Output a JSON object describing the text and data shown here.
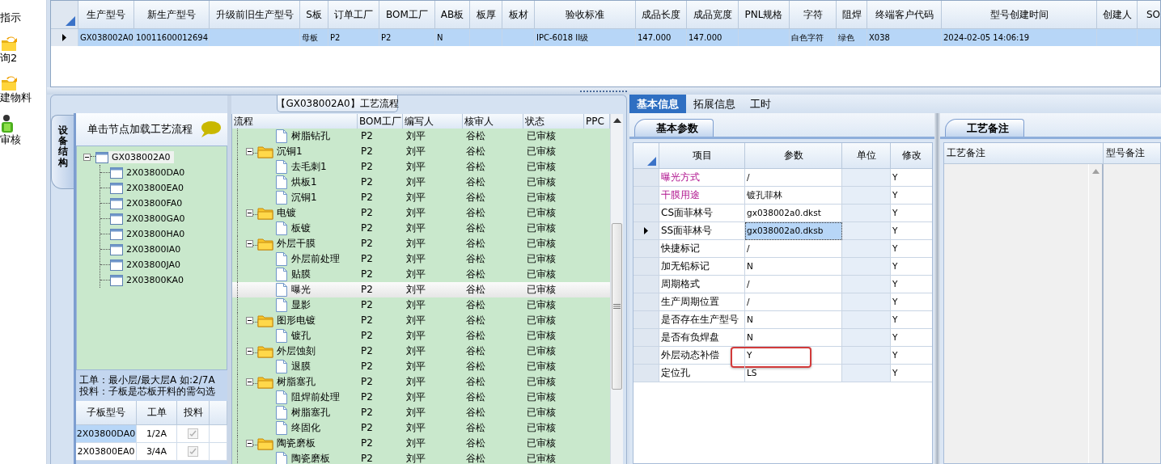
{
  "sidebar": {
    "items": [
      {
        "label": "指示"
      },
      {
        "label": "询2",
        "kind": "folder"
      },
      {
        "label": "建物料",
        "kind": "folder"
      },
      {
        "label": "审核",
        "kind": "approve"
      }
    ]
  },
  "main_grid": {
    "columns": [
      "生产型号",
      "新生产型号",
      "升级前旧生产型号",
      "S板",
      "订单工厂",
      "BOM工厂",
      "AB板",
      "板厚",
      "板材",
      "验收标准",
      "成品长度",
      "成品宽度",
      "PNL规格",
      "字符",
      "阻焊",
      "终端客户代码",
      "型号创建时间",
      "创建人",
      "SO"
    ],
    "rows": [
      {
        "selected": true,
        "cells": [
          "GX038002A0",
          "10011600012694",
          null,
          "母板",
          "P2",
          "P2",
          "N",
          null,
          null,
          "IPC-6018 II级",
          "147.000",
          "147.000",
          null,
          "白色字符",
          "绿色",
          "X038",
          "2024-02-05 14:06:19",
          null,
          null
        ]
      }
    ]
  },
  "structure_panel": {
    "side_tab": "设备结构",
    "hint": "单击节点加载工艺流程",
    "tree": {
      "label": "GX038002A0",
      "expanded": true,
      "selected": true,
      "children": [
        {
          "label": "2X03800DA0",
          "selected": false
        },
        {
          "label": "2X03800EA0",
          "selected": false
        },
        {
          "label": "2X03800FA0",
          "selected": false
        },
        {
          "label": "2X03800GA0",
          "selected": false
        },
        {
          "label": "2X03800HA0",
          "selected": false
        },
        {
          "label": "2X03800IA0",
          "selected": false
        },
        {
          "label": "2X03800JA0",
          "selected": false
        },
        {
          "label": "2X03800KA0",
          "selected": false
        }
      ]
    },
    "notes": [
      "工单：最小层/最大层A 如:2/7A",
      "投料：子板是芯板开料的需勾选"
    ],
    "sub_table": {
      "columns": [
        "子板型号",
        "工单",
        "投料"
      ],
      "rows": [
        {
          "board": "2X03800DA0",
          "order": "1/2A",
          "checked": true,
          "selected": true
        },
        {
          "board": "2X03800EA0",
          "order": "3/4A",
          "checked": true,
          "selected": false
        }
      ]
    }
  },
  "process_panel": {
    "title": "【GX038002A0】工艺流程",
    "columns": [
      "流程",
      "BOM工厂",
      "编写人",
      "核审人",
      "状态",
      "PPC"
    ],
    "nodes": [
      {
        "kind": "folder",
        "children": [
          {
            "kind": "file",
            "label": "树脂钻孔",
            "bom": "P2",
            "writer": "刘平",
            "reviewer": "谷松",
            "status": "已审核",
            "selected": false
          }
        ]
      },
      {
        "kind": "folder",
        "label": "沉铜1",
        "bom": "P2",
        "writer": "刘平",
        "reviewer": "谷松",
        "status": "已审核",
        "selected": false,
        "expanded": true,
        "children": [
          {
            "kind": "file",
            "label": "去毛刺1",
            "bom": "P2",
            "writer": "刘平",
            "reviewer": "谷松",
            "status": "已审核",
            "selected": false
          },
          {
            "kind": "file",
            "label": "烘板1",
            "bom": "P2",
            "writer": "刘平",
            "reviewer": "谷松",
            "status": "已审核",
            "selected": false
          },
          {
            "kind": "file",
            "label": "沉铜1",
            "bom": "P2",
            "writer": "刘平",
            "reviewer": "谷松",
            "status": "已审核",
            "selected": false
          }
        ]
      },
      {
        "kind": "folder",
        "label": "电镀",
        "bom": "P2",
        "writer": "刘平",
        "reviewer": "谷松",
        "status": "已审核",
        "selected": false,
        "expanded": true,
        "children": [
          {
            "kind": "file",
            "label": "板镀",
            "bom": "P2",
            "writer": "刘平",
            "reviewer": "谷松",
            "status": "已审核",
            "selected": false
          }
        ]
      },
      {
        "kind": "folder",
        "label": "外层干膜",
        "bom": "P2",
        "writer": "刘平",
        "reviewer": "谷松",
        "status": "已审核",
        "selected": false,
        "expanded": true,
        "children": [
          {
            "kind": "file",
            "label": "外层前处理",
            "bom": "P2",
            "writer": "刘平",
            "reviewer": "谷松",
            "status": "已审核",
            "selected": false
          },
          {
            "kind": "file",
            "label": "贴膜",
            "bom": "P2",
            "writer": "刘平",
            "reviewer": "谷松",
            "status": "已审核",
            "selected": false
          },
          {
            "kind": "file",
            "label": "曝光",
            "bom": "P2",
            "writer": "刘平",
            "reviewer": "谷松",
            "status": "已审核",
            "selected": true
          },
          {
            "kind": "file",
            "label": "显影",
            "bom": "P2",
            "writer": "刘平",
            "reviewer": "谷松",
            "status": "已审核",
            "selected": false
          }
        ]
      },
      {
        "kind": "folder",
        "label": "图形电镀",
        "bom": "P2",
        "writer": "刘平",
        "reviewer": "谷松",
        "status": "已审核",
        "selected": false,
        "expanded": true,
        "children": [
          {
            "kind": "file",
            "label": "镀孔",
            "bom": "P2",
            "writer": "刘平",
            "reviewer": "谷松",
            "status": "已审核",
            "selected": false
          }
        ]
      },
      {
        "kind": "folder",
        "label": "外层蚀刻",
        "bom": "P2",
        "writer": "刘平",
        "reviewer": "谷松",
        "status": "已审核",
        "selected": false,
        "expanded": true,
        "children": [
          {
            "kind": "file",
            "label": "退膜",
            "bom": "P2",
            "writer": "刘平",
            "reviewer": "谷松",
            "status": "已审核",
            "selected": false
          }
        ]
      },
      {
        "kind": "folder",
        "label": "树脂塞孔",
        "bom": "P2",
        "writer": "刘平",
        "reviewer": "谷松",
        "status": "已审核",
        "selected": false,
        "expanded": true,
        "children": [
          {
            "kind": "file",
            "label": "阻焊前处理",
            "bom": "P2",
            "writer": "刘平",
            "reviewer": "谷松",
            "status": "已审核",
            "selected": false
          },
          {
            "kind": "file",
            "label": "树脂塞孔",
            "bom": "P2",
            "writer": "刘平",
            "reviewer": "谷松",
            "status": "已审核",
            "selected": false
          },
          {
            "kind": "file",
            "label": "终固化",
            "bom": "P2",
            "writer": "刘平",
            "reviewer": "谷松",
            "status": "已审核",
            "selected": false
          }
        ]
      },
      {
        "kind": "folder",
        "label": "陶瓷磨板",
        "bom": "P2",
        "writer": "刘平",
        "reviewer": "谷松",
        "status": "已审核",
        "selected": false,
        "expanded": true,
        "children": [
          {
            "kind": "file",
            "label": "陶瓷磨板",
            "bom": "P2",
            "writer": "刘平",
            "reviewer": "谷松",
            "status": "已审核",
            "selected": false
          }
        ]
      }
    ]
  },
  "tabs": [
    {
      "label": "基本信息",
      "selected": true
    },
    {
      "label": "拓展信息",
      "selected": false
    },
    {
      "label": "工时",
      "selected": false
    }
  ],
  "params_panel": {
    "tab": "基本参数",
    "columns": [
      "项目",
      "参数",
      "单位",
      "修改"
    ],
    "rows": [
      {
        "item": "曝光方式",
        "value": "/",
        "modify": "Y",
        "highlight": true,
        "selected": false,
        "annotated": false
      },
      {
        "item": "干膜用途",
        "value": "镀孔菲林",
        "modify": "Y",
        "highlight": true,
        "selected": false,
        "annotated": false
      },
      {
        "item": "CS面菲林号",
        "value": "gx038002a0.dkst",
        "modify": "Y",
        "highlight": false,
        "selected": false,
        "annotated": false
      },
      {
        "item": "SS面菲林号",
        "value": "gx038002a0.dksb",
        "modify": "Y",
        "highlight": false,
        "selected": true,
        "annotated": false
      },
      {
        "item": "快捷标记",
        "value": "/",
        "modify": "Y",
        "highlight": false,
        "selected": false,
        "annotated": false
      },
      {
        "item": "加无铅标记",
        "value": "N",
        "modify": "Y",
        "highlight": false,
        "selected": false,
        "annotated": false
      },
      {
        "item": "周期格式",
        "value": "/",
        "modify": "Y",
        "highlight": false,
        "selected": false,
        "annotated": false
      },
      {
        "item": "生产周期位置",
        "value": "/",
        "modify": "Y",
        "highlight": false,
        "selected": false,
        "annotated": false
      },
      {
        "item": "是否存在生产型号",
        "value": "N",
        "modify": "Y",
        "highlight": false,
        "selected": false,
        "annotated": false
      },
      {
        "item": "是否有负焊盘",
        "value": "N",
        "modify": "Y",
        "highlight": false,
        "selected": false,
        "annotated": false
      },
      {
        "item": "外层动态补偿",
        "value": "Y",
        "modify": "Y",
        "highlight": false,
        "selected": false,
        "annotated": true
      },
      {
        "item": "定位孔",
        "value": "LS",
        "modify": "Y",
        "highlight": false,
        "selected": false,
        "annotated": false
      }
    ]
  },
  "notes_panel": {
    "tab": "工艺备注",
    "columns": [
      "工艺备注",
      "型号备注"
    ]
  }
}
